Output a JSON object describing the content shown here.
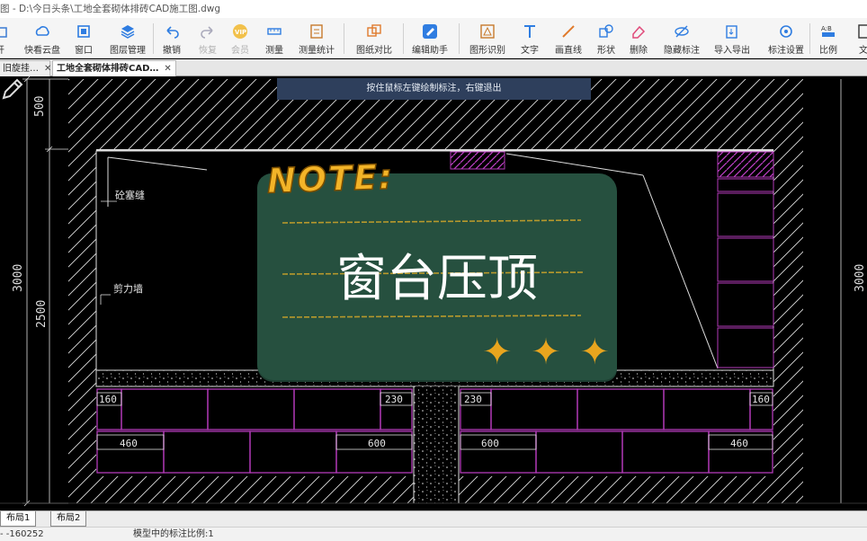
{
  "window": {
    "title": "图 - D:\\今日头条\\工地全套砌体排砖CAD施工图.dwg"
  },
  "toolbar": {
    "buttons": [
      {
        "id": "open",
        "label": "开",
        "icon": "folder-icon"
      },
      {
        "id": "cloud",
        "label": "快看云盘",
        "icon": "cloud-icon"
      },
      {
        "id": "window",
        "label": "窗口",
        "icon": "window-icon"
      },
      {
        "id": "layers",
        "label": "图层管理",
        "icon": "layers-icon"
      },
      {
        "id": "undo",
        "label": "撤销",
        "icon": "undo-icon"
      },
      {
        "id": "redo",
        "label": "恢复",
        "icon": "redo-icon"
      },
      {
        "id": "vip",
        "label": "会员",
        "icon": "vip-icon"
      },
      {
        "id": "measure",
        "label": "测量",
        "icon": "ruler-icon"
      },
      {
        "id": "measure-stats",
        "label": "测量统计",
        "icon": "measure-stats-icon"
      },
      {
        "id": "compare",
        "label": "图纸对比",
        "icon": "compare-icon"
      },
      {
        "id": "edit-assist",
        "label": "编辑助手",
        "icon": "edit-assistant-icon"
      },
      {
        "id": "shape-recog",
        "label": "图形识别",
        "icon": "shape-recognition-icon"
      },
      {
        "id": "text",
        "label": "文字",
        "icon": "text-icon"
      },
      {
        "id": "line",
        "label": "画直线",
        "icon": "line-icon"
      },
      {
        "id": "shape",
        "label": "形状",
        "icon": "shape-icon"
      },
      {
        "id": "delete",
        "label": "删除",
        "icon": "eraser-icon"
      },
      {
        "id": "hide-dim",
        "label": "隐藏标注",
        "icon": "hide-annotation-icon"
      },
      {
        "id": "import-export",
        "label": "导入导出",
        "icon": "import-export-icon"
      },
      {
        "id": "dim-settings",
        "label": "标注设置",
        "icon": "annotation-settings-icon"
      },
      {
        "id": "scale",
        "label": "比例",
        "icon": "scale-icon"
      },
      {
        "id": "more",
        "label": "文",
        "icon": "document-icon"
      }
    ]
  },
  "tabs": [
    {
      "label": "旧旋挂…",
      "close": "✕",
      "active": false
    },
    {
      "label": "工地全套砌体排砖CAD…",
      "close": "✕",
      "active": true
    }
  ],
  "canvas": {
    "hint": "按住鼠标左键绘制标注，右键退出",
    "dims_left": [
      "500",
      "3000",
      "2500"
    ],
    "dims_right": [
      "3000"
    ],
    "labels": {
      "crack": "砼塞缝",
      "shear_wall": "剪力墙"
    },
    "bricks": {
      "left_small": "160",
      "left_230": "230",
      "right_230": "230",
      "right_small": "160",
      "left_460": "460",
      "left_600": "600",
      "right_600": "600",
      "right_460": "460"
    },
    "colors": {
      "brick": "#b23ab8",
      "hatch": "#d8d8d8",
      "card": "#26503f",
      "note": "#f3b428"
    }
  },
  "note": {
    "title": "NOTE:",
    "body": "窗台压顶",
    "stars": "✦ ✦ ✦"
  },
  "layouts": [
    {
      "label": "布局1",
      "active": true
    },
    {
      "label": "布局2",
      "active": false
    }
  ],
  "status": {
    "coord": "- -160252",
    "scale": "模型中的标注比例:1"
  }
}
